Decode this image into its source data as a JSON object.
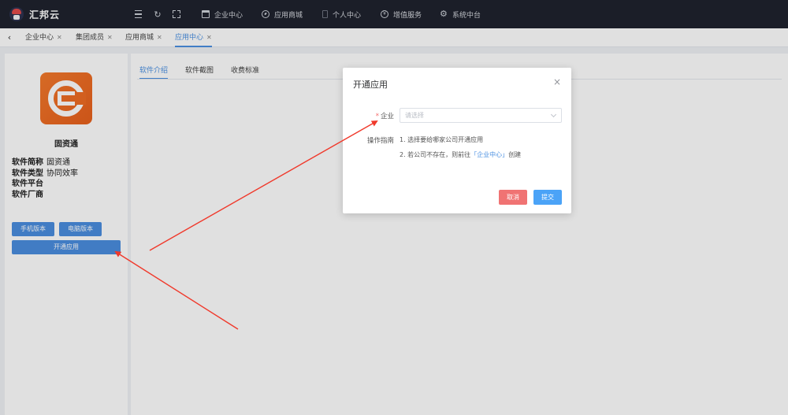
{
  "topbar": {
    "brand_name": "汇邦云",
    "tools": [
      {
        "icon": "menu-icon"
      },
      {
        "icon": "refresh-icon"
      },
      {
        "icon": "fullscreen-icon"
      }
    ],
    "nav": [
      {
        "icon": "building-icon",
        "label": "企业中心"
      },
      {
        "icon": "compass-icon",
        "label": "应用商城"
      },
      {
        "icon": "phone-icon",
        "label": "个人中心"
      },
      {
        "icon": "coin-icon",
        "label": "增值服务"
      },
      {
        "icon": "gear-icon",
        "label": "系统中台"
      }
    ],
    "background": "#1f232e"
  },
  "tabs": [
    {
      "label": "企业中心",
      "active": false
    },
    {
      "label": "集团成员",
      "active": false
    },
    {
      "label": "应用商城",
      "active": false
    },
    {
      "label": "应用中心",
      "active": true
    }
  ],
  "left_panel": {
    "app_name": "固资通",
    "info": [
      {
        "key": "软件简称",
        "value": "固资通"
      },
      {
        "key": "软件类型",
        "value": "协同效率"
      },
      {
        "key": "软件平台",
        "value": ""
      },
      {
        "key": "软件厂商",
        "value": ""
      }
    ],
    "buttons": {
      "mobile": "手机版本",
      "desktop": "电脑版本",
      "open_app": "开通应用"
    }
  },
  "main": {
    "tabs": [
      {
        "label": "软件介绍",
        "active": true
      },
      {
        "label": "软件截图",
        "active": false
      },
      {
        "label": "收费标准",
        "active": false
      }
    ]
  },
  "dialog": {
    "title": "开通应用",
    "company_label": "企业",
    "company_placeholder": "请选择",
    "guide_label": "操作指南",
    "guide_line1": "1. 选择要给哪家公司开通应用",
    "guide_line2_before": "2. 若公司不存在，则前往",
    "guide_link": "「企业中心」",
    "guide_line2_after": "创建",
    "cancel_label": "取消",
    "submit_label": "提交"
  },
  "colors": {
    "accent": "#4a90e2",
    "primary_button": "#4a8ee0",
    "cancel_button": "#f07373",
    "submit_button": "#4ba3f7",
    "annotation_arrow": "#f0392b"
  }
}
